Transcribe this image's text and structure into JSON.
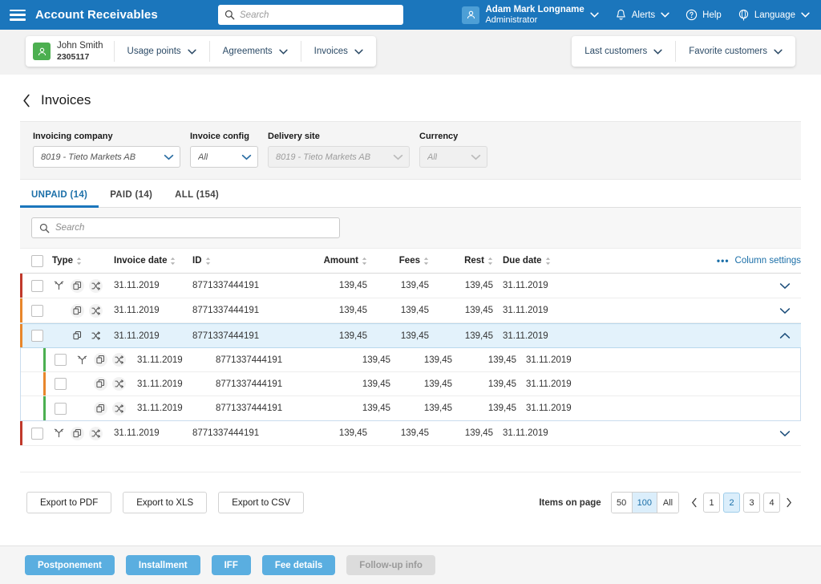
{
  "topbar": {
    "menu_icon": "hamburger-icon",
    "app_title": "Account Receivables",
    "search_placeholder": "Search",
    "search_icon": "search-icon",
    "user": {
      "name": "Adam Mark Longname",
      "role": "Administrator",
      "avatar_icon": "user-avatar-icon"
    },
    "alerts": {
      "label": "Alerts",
      "icon": "bell-icon"
    },
    "help": {
      "label": "Help",
      "icon": "question-circle-icon"
    },
    "language": {
      "label": "Language",
      "icon": "globe-icon"
    },
    "accent": "#1b76bc"
  },
  "customer_bar": {
    "customer": {
      "name": "John Smith",
      "number": "2305117",
      "avatar_icon": "user-avatar-icon",
      "avatar_color": "#4caf50"
    },
    "menus": [
      {
        "label": "Usage points",
        "icon": "chevron-down-icon"
      },
      {
        "label": "Agreements",
        "icon": "chevron-down-icon"
      },
      {
        "label": "Invoices",
        "icon": "chevron-down-icon"
      }
    ],
    "right_menus": [
      {
        "label": "Last customers",
        "icon": "chevron-down-icon"
      },
      {
        "label": "Favorite customers",
        "icon": "chevron-down-icon"
      }
    ]
  },
  "page": {
    "back_icon": "chevron-left-icon",
    "title": "Invoices"
  },
  "filters": [
    {
      "label": "Invoicing company",
      "value": "8019 - Tieto Markets AB",
      "disabled": false,
      "width_class": "w-invcomp"
    },
    {
      "label": "Invoice config",
      "value": "All",
      "disabled": false,
      "width_class": "w-invcfg"
    },
    {
      "label": "Delivery site",
      "value": "8019 - Tieto Markets AB",
      "disabled": true,
      "width_class": "w-delsite"
    },
    {
      "label": "Currency",
      "value": "All",
      "disabled": true,
      "width_class": "w-curr"
    }
  ],
  "tabs": [
    {
      "label": "UNPAID (14)",
      "active": true
    },
    {
      "label": "PAID (14)",
      "active": false
    },
    {
      "label": "ALL (154)",
      "active": false
    }
  ],
  "table_search": {
    "placeholder": "Search",
    "icon": "search-icon"
  },
  "table": {
    "columns": [
      {
        "key": "type",
        "label": "Type",
        "sortable": true
      },
      {
        "key": "date",
        "label": "Invoice date",
        "sortable": true
      },
      {
        "key": "id",
        "label": "ID",
        "sortable": true
      },
      {
        "key": "amount",
        "label": "Amount",
        "sortable": true
      },
      {
        "key": "fees",
        "label": "Fees",
        "sortable": true
      },
      {
        "key": "rest",
        "label": "Rest",
        "sortable": true
      },
      {
        "key": "due",
        "label": "Due date",
        "sortable": true
      }
    ],
    "column_settings": {
      "label": "Column settings",
      "icon": "ellipsis-icon"
    },
    "select_all_checkbox": false,
    "rows": [
      {
        "status_color": "#c0392b",
        "checked": false,
        "icons": [
          "branch-icon",
          "copy-icon",
          "shuffle-icon"
        ],
        "date": "31.11.2019",
        "id": "8771337444191",
        "amount": "139,45",
        "fees": "139,45",
        "rest": "139,45",
        "due": "31.11.2019",
        "expanded": false,
        "expand_icon": "chevron-down-icon",
        "selected": false,
        "sub_rows": []
      },
      {
        "status_color": "#e8862b",
        "checked": false,
        "icons": [
          "copy-icon",
          "shuffle-icon"
        ],
        "date": "31.11.2019",
        "id": "8771337444191",
        "amount": "139,45",
        "fees": "139,45",
        "rest": "139,45",
        "due": "31.11.2019",
        "expanded": false,
        "expand_icon": "chevron-down-icon",
        "selected": false,
        "sub_rows": []
      },
      {
        "status_color": "#e8862b",
        "checked": false,
        "icons": [
          "copy-icon",
          "shuffle-icon"
        ],
        "date": "31.11.2019",
        "id": "8771337444191",
        "amount": "139,45",
        "fees": "139,45",
        "rest": "139,45",
        "due": "31.11.2019",
        "expanded": true,
        "expand_icon": "chevron-up-icon",
        "selected": true,
        "sub_rows": [
          {
            "status_color": "#4caf50",
            "checked": false,
            "icons": [
              "branch-icon",
              "copy-icon",
              "shuffle-icon"
            ],
            "date": "31.11.2019",
            "id": "8771337444191",
            "amount": "139,45",
            "fees": "139,45",
            "rest": "139,45",
            "due": "31.11.2019"
          },
          {
            "status_color": "#e8862b",
            "checked": false,
            "icons": [
              "copy-icon",
              "shuffle-icon"
            ],
            "date": "31.11.2019",
            "id": "8771337444191",
            "amount": "139,45",
            "fees": "139,45",
            "rest": "139,45",
            "due": "31.11.2019"
          },
          {
            "status_color": "#4caf50",
            "checked": false,
            "icons": [
              "copy-icon",
              "shuffle-icon"
            ],
            "date": "31.11.2019",
            "id": "8771337444191",
            "amount": "139,45",
            "fees": "139,45",
            "rest": "139,45",
            "due": "31.11.2019"
          }
        ]
      },
      {
        "status_color": "#c0392b",
        "checked": false,
        "icons": [
          "branch-icon",
          "copy-icon",
          "shuffle-icon"
        ],
        "date": "31.11.2019",
        "id": "8771337444191",
        "amount": "139,45",
        "fees": "139,45",
        "rest": "139,45",
        "due": "31.11.2019",
        "expanded": false,
        "expand_icon": "chevron-down-icon",
        "selected": false,
        "sub_rows": []
      }
    ]
  },
  "footer": {
    "export_buttons": [
      {
        "label": "Export to PDF"
      },
      {
        "label": "Export to XLS"
      },
      {
        "label": "Export to CSV"
      }
    ],
    "items_on_page": {
      "label": "Items on page",
      "options": [
        {
          "label": "50",
          "selected": false
        },
        {
          "label": "100",
          "selected": true
        },
        {
          "label": "All",
          "selected": false
        }
      ]
    },
    "pagination": {
      "prev_icon": "chevron-left-icon",
      "next_icon": "chevron-right-icon",
      "pages": [
        {
          "label": "1",
          "selected": false
        },
        {
          "label": "2",
          "selected": true
        },
        {
          "label": "3",
          "selected": false
        },
        {
          "label": "4",
          "selected": false
        }
      ]
    }
  },
  "action_bar": {
    "buttons": [
      {
        "label": "Postponement",
        "disabled": false
      },
      {
        "label": "Installment",
        "disabled": false
      },
      {
        "label": "IFF",
        "disabled": false
      },
      {
        "label": "Fee details",
        "disabled": false
      },
      {
        "label": "Follow-up info",
        "disabled": true
      }
    ]
  }
}
